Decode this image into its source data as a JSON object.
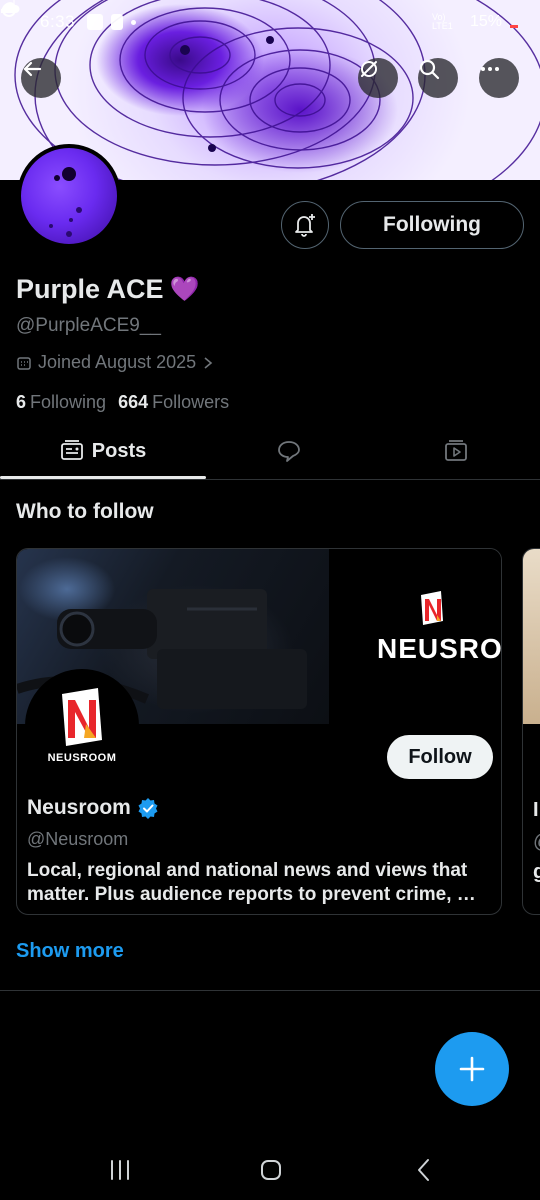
{
  "status_bar": {
    "time": "6:33",
    "network_label": "Vo) LTE1",
    "battery": "15%",
    "battery_color": "#ff4444"
  },
  "header": {
    "back_icon": "arrow-left-icon",
    "grok_icon": "slash-circle-icon",
    "search_icon": "search-icon",
    "more_icon": "more-horizontal-icon",
    "banner_accent": "#7b2cff"
  },
  "profile": {
    "display_name": "Purple ACE",
    "name_emoji": "💜",
    "handle": "@PurpleACE9__",
    "joined": "Joined August 2025",
    "following_count": "6",
    "following_label": "Following",
    "followers_count": "664",
    "followers_label": "Followers",
    "follow_state_button": "Following"
  },
  "tabs": [
    {
      "label": "Posts",
      "icon": "posts-icon",
      "active": true
    },
    {
      "label": "",
      "icon": "reply-bubble-icon",
      "active": false
    },
    {
      "label": "",
      "icon": "media-icon",
      "active": false
    }
  ],
  "who_to_follow": {
    "title": "Who to follow",
    "cards": [
      {
        "brand_banner_text": "NEUSROOM",
        "avatar_text": "NEUSROOM",
        "name": "Neusroom",
        "verified": true,
        "handle": "@Neusroom",
        "bio": "Local, regional and national news and views that matter. Plus audience reports to prevent crime, …",
        "follow_label": "Follow"
      }
    ],
    "peek_chars": [
      "I",
      "@",
      "g"
    ],
    "show_more": "Show more"
  },
  "fab": {
    "icon": "plus-icon",
    "color": "#1d9bf0"
  },
  "system_nav": {
    "recents_icon": "recents-icon",
    "home_icon": "home-icon",
    "back_icon": "back-chevron-icon"
  }
}
